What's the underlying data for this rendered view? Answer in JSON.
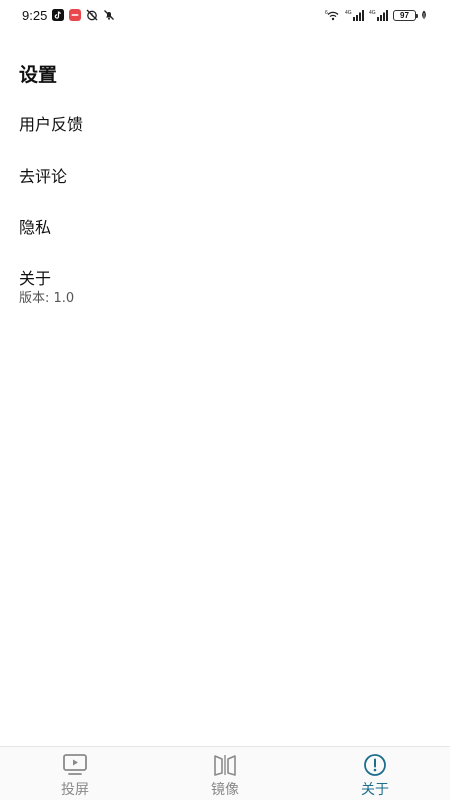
{
  "status_bar": {
    "time": "9:25",
    "battery": "97",
    "network_labels": [
      "4G",
      "4G"
    ],
    "notification_icons": [
      "tiktok-icon",
      "red-app-icon",
      "alarm-off-icon",
      "mute-icon"
    ],
    "right_icons": [
      "nfc-icon",
      "wifi-icon",
      "signal-icon",
      "signal-icon",
      "battery-icon",
      "leaf-icon"
    ]
  },
  "page": {
    "title": "设置"
  },
  "menu": {
    "feedback": "用户反馈",
    "review": "去评论",
    "privacy": "隐私",
    "about": "关于",
    "version": "版本: 1.0"
  },
  "bottom_nav": {
    "items": [
      {
        "label": "投屏",
        "icon": "screen-cast-icon",
        "active": false
      },
      {
        "label": "镜像",
        "icon": "mirror-icon",
        "active": false
      },
      {
        "label": "关于",
        "icon": "info-icon",
        "active": true
      }
    ],
    "colors": {
      "active": "#1c6e8c",
      "inactive": "#8a8a8a"
    }
  }
}
